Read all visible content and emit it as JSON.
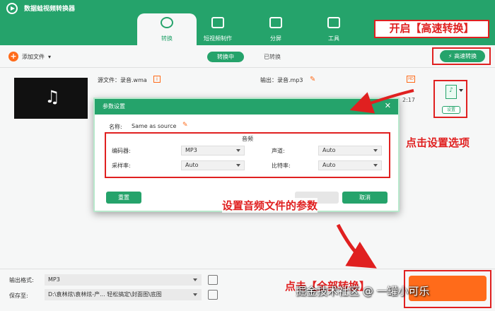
{
  "app": {
    "title": "数据蛙视频转换器"
  },
  "tabs": [
    {
      "label": "转换",
      "icon": "convert-icon",
      "active": true
    },
    {
      "label": "短视频制作",
      "icon": "tv-icon",
      "active": false
    },
    {
      "label": "分屏",
      "icon": "split-screen-icon",
      "active": false
    },
    {
      "label": "工具",
      "icon": "toolbox-icon",
      "active": false
    }
  ],
  "toolbar": {
    "add_file": "添加文件",
    "converting": "转换中",
    "converted": "已转换",
    "fast_convert": "高速转换"
  },
  "file": {
    "source": "源文件：录音.wma",
    "output": "输出：录音.mp3",
    "duration": "2:17",
    "settings": "设置"
  },
  "dialog": {
    "title": "参数设置",
    "name_label": "名称:",
    "name_value": "Same as source",
    "section_title": "音频",
    "encoder_label": "编码器:",
    "encoder_value": "MP3",
    "channel_label": "声道:",
    "channel_value": "Auto",
    "sample_rate_label": "采样率:",
    "sample_rate_value": "Auto",
    "bitrate_label": "比特率:",
    "bitrate_value": "Auto",
    "reset": "重置",
    "cancel": "取消"
  },
  "bottom": {
    "output_format_label": "输出格式:",
    "output_format_value": "MP3",
    "save_to_label": "保存至:",
    "save_to_value": "D:\\袁林炫\\袁林炫-产...  轻松搞定\\封面图\\底图"
  },
  "annotations": {
    "fast_convert": "开启【高速转换】",
    "settings": "点击设置选项",
    "params": "设置音频文件的参数",
    "convert_all": "点击【全部转换】"
  },
  "watermark": "掘金技术社区 @ 一罐小可乐",
  "colors": {
    "brand": "#25a36b",
    "accent": "#ff6b1a",
    "annotation": "#e02020"
  }
}
